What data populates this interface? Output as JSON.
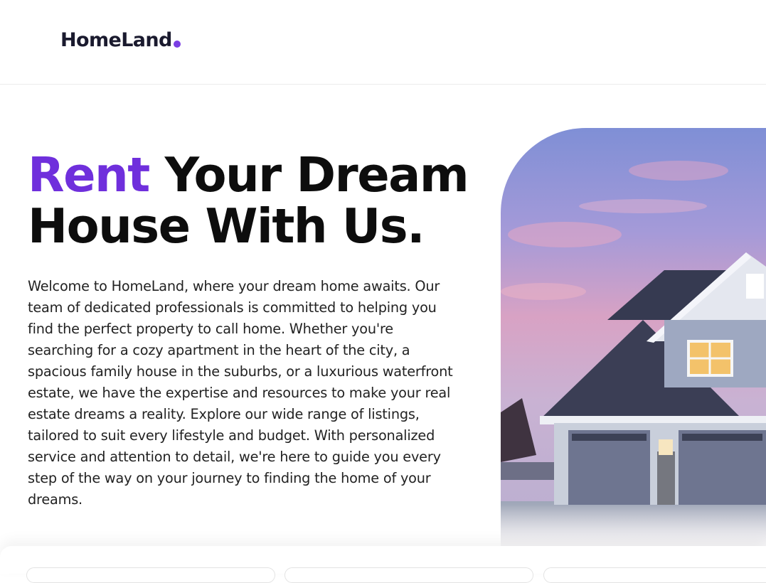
{
  "header": {
    "logo_text": "HomeLand"
  },
  "hero": {
    "title_accent": "Rent",
    "title_line1_rest": " Your Dream",
    "title_line2": "House With Us.",
    "description": "Welcome to HomeLand, where your dream home awaits. Our team of dedicated professionals is committed to helping you find the perfect property to call home. Whether you're searching for a cozy apartment in the heart of the city, a spacious family house in the suburbs, or a luxurious waterfront estate, we have the expertise and resources to make your real estate dreams a reality. Explore our wide range of listings, tailored to suit every lifestyle and budget. With personalized service and attention to detail, we're here to guide you every step of the way on your journey to finding the home of your dreams."
  },
  "colors": {
    "accent": "#6f2fdc",
    "logo_dot": "#7b3fe4",
    "heading": "#0d0d0d"
  }
}
